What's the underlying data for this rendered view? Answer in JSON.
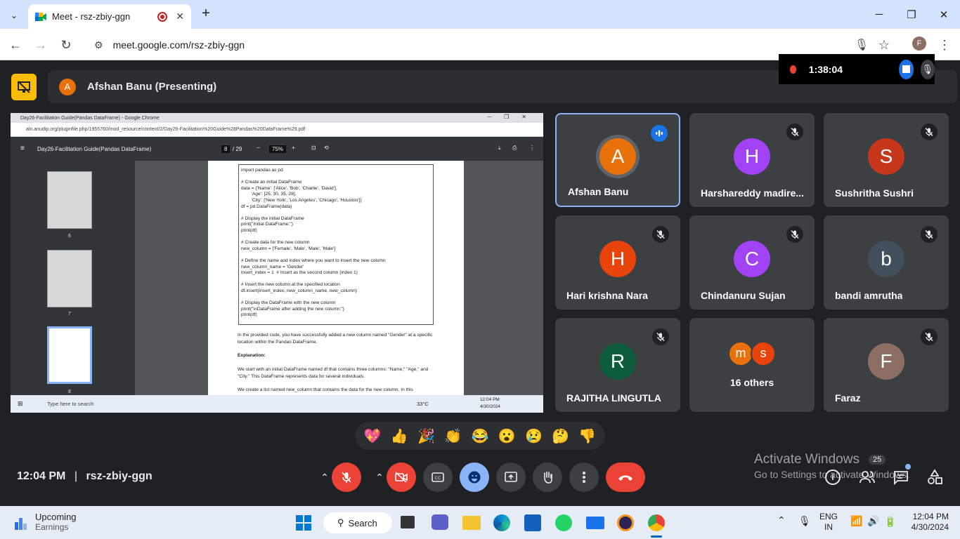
{
  "browser": {
    "tab_title": "Meet - rsz-zbiy-ggn",
    "url": "meet.google.com/rsz-zbiy-ggn",
    "profile_initial": "F"
  },
  "recording": {
    "timer": "1:38:04"
  },
  "presenter": {
    "initial": "A",
    "label": "Afshan Banu (Presenting)"
  },
  "shared_screen": {
    "window_title": "Day26-Facilitation Guide(Pandas DataFrame) - Google Chrome",
    "url": "aln.anudip.org/pluginfile.php/1955760/mod_resource/content/2/Day26-Facilitation%20Guide%28Pandas%20DataFrame%29.pdf",
    "doc_title": "Day26-Facilitation Guide(Pandas DataFrame)",
    "page_current": "8",
    "page_total": "/ 29",
    "zoom": "75%",
    "thumbs": [
      "6",
      "7",
      "8"
    ],
    "code_lines": [
      "import pandas as pd",
      "",
      "# Create an initial DataFrame",
      "data = {'Name': ['Alice', 'Bob', 'Charlie', 'David'],",
      "        'Age': [25, 30, 35, 28],",
      "        'City': ['New York', 'Los Angeles', 'Chicago', 'Houston']}",
      "df = pd.DataFrame(data)",
      "",
      "# Display the initial DataFrame",
      "print(\"Initial DataFrame:\")",
      "print(df)",
      "",
      "# Create data for the new column",
      "new_column = ['Female', 'Male', 'Male', 'Male']",
      "",
      "# Define the name and index where you want to insert the new column",
      "new_column_name = 'Gender'",
      "insert_index = 1  # Insert as the second column (index 1)",
      "",
      "# Insert the new column at the specified location",
      "df.insert(insert_index, new_column_name, new_column)",
      "",
      "# Display the DataFrame with the new column",
      "print(\"\\nDataFrame after adding the new column:\")",
      "print(df)"
    ],
    "para1": "In the provided code, you have successfully added a new column named \"Gender\" at a specific location within the Pandas DataFrame.",
    "explanation_heading": "Explanation:",
    "para2": "We start with an initial DataFrame named df that contains three columns: \"Name,\" \"Age,\" and \"City.\" This DataFrame represents data for several individuals.",
    "para3": "We create a list named new_column that contains the data for the new column. In this",
    "taskbar_search": "Type here to search",
    "taskbar_temp": "33°C",
    "taskbar_time": "12:04 PM",
    "taskbar_date": "4/30/2024"
  },
  "participants": [
    {
      "name": "Afshan Banu",
      "initial": "A",
      "color": "#e8710a",
      "speaking": true
    },
    {
      "name": "Harshareddy madire...",
      "initial": "H",
      "color": "#a142f4",
      "muted": true
    },
    {
      "name": "Sushritha Sushri",
      "initial": "S",
      "color": "#c5361b",
      "muted": true
    },
    {
      "name": "Hari krishna Nara",
      "initial": "H",
      "color": "#e8430a",
      "muted": true
    },
    {
      "name": "Chindanuru Sujan",
      "initial": "C",
      "color": "#a142f4",
      "muted": true
    },
    {
      "name": "bandi amrutha",
      "initial": "b",
      "color": "#41505c",
      "muted": true
    },
    {
      "name": "RAJITHA LINGUTLA",
      "initial": "R",
      "color": "#0d5c3c",
      "muted": true
    },
    {
      "name": "16 others",
      "initials": [
        "m",
        "s"
      ],
      "colors": [
        "#e8710a",
        "#e8430a"
      ]
    },
    {
      "name": "Faraz",
      "initial": "F",
      "color": "#8d6e63",
      "muted": true
    }
  ],
  "reactions": [
    "💖",
    "👍",
    "🎉",
    "👏",
    "😂",
    "😮",
    "😢",
    "🤔",
    "👎"
  ],
  "meeting": {
    "time": "12:04 PM",
    "separator": "|",
    "code": "rsz-zbiy-ggn"
  },
  "watermark": {
    "line1": "Activate Windows",
    "line2": "Go to Settings to activate Windows.",
    "badge": "25"
  },
  "taskbar": {
    "widget_title": "Upcoming",
    "widget_sub": "Earnings",
    "search": "Search",
    "lang1": "ENG",
    "lang2": "IN",
    "time": "12:04 PM",
    "date": "4/30/2024"
  }
}
